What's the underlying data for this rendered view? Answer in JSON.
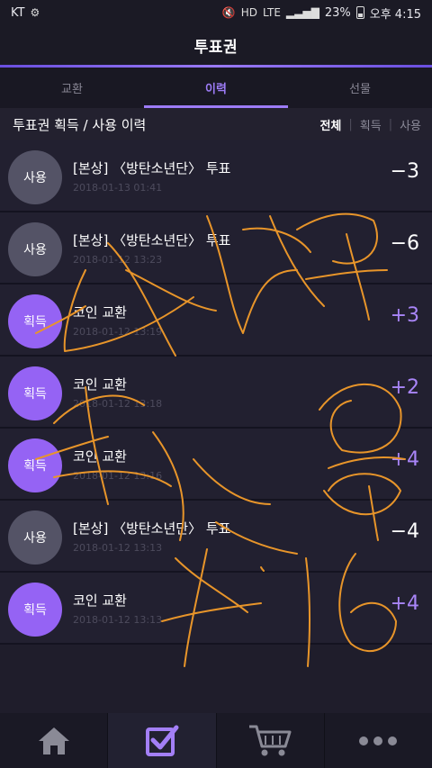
{
  "status_bar": {
    "carrier": "KT",
    "network": "LTE",
    "hd": "HD",
    "battery": "23%",
    "time": "오후 4:15"
  },
  "header": {
    "title": "투표권"
  },
  "tabs": [
    {
      "label": "교환",
      "active": false
    },
    {
      "label": "이력",
      "active": true
    },
    {
      "label": "선물",
      "active": false
    }
  ],
  "subheader": {
    "title": "투표권 획득 / 사용 이력",
    "filters": [
      "전체",
      "획득",
      "사용"
    ],
    "active_filter": "전체"
  },
  "history": [
    {
      "badge": "사용",
      "type": "use",
      "title": "[본상] 〈방탄소년단〉 투표",
      "date": "2018-01-13 01:41",
      "amount": "−3"
    },
    {
      "badge": "사용",
      "type": "use",
      "title": "[본상] 〈방탄소년단〉 투표",
      "date": "2018-01-12 13:23",
      "amount": "−6"
    },
    {
      "badge": "획득",
      "type": "earn",
      "title": "코인 교환",
      "date": "2018-01-12 13:19",
      "amount": "+3"
    },
    {
      "badge": "획득",
      "type": "earn",
      "title": "코인 교환",
      "date": "2018-01-12 13:18",
      "amount": "+2"
    },
    {
      "badge": "획득",
      "type": "earn",
      "title": "코인 교환",
      "date": "2018-01-12 13:16",
      "amount": "+4"
    },
    {
      "badge": "사용",
      "type": "use",
      "title": "[본상] 〈방탄소년단〉 투표",
      "date": "2018-01-12 13:13",
      "amount": "−4"
    },
    {
      "badge": "획득",
      "type": "earn",
      "title": "코인 교환",
      "date": "2018-01-12 13:13",
      "amount": "+4"
    }
  ],
  "colors": {
    "accent": "#9d7cf7",
    "earn_badge": "#9563f4",
    "use_badge": "#545366",
    "scribble": "#e8952a"
  },
  "bottom_nav": [
    {
      "icon": "home-icon",
      "active": false
    },
    {
      "icon": "checkbox-icon",
      "active": true
    },
    {
      "icon": "cart-icon",
      "active": false
    },
    {
      "icon": "more-icon",
      "active": false
    }
  ]
}
